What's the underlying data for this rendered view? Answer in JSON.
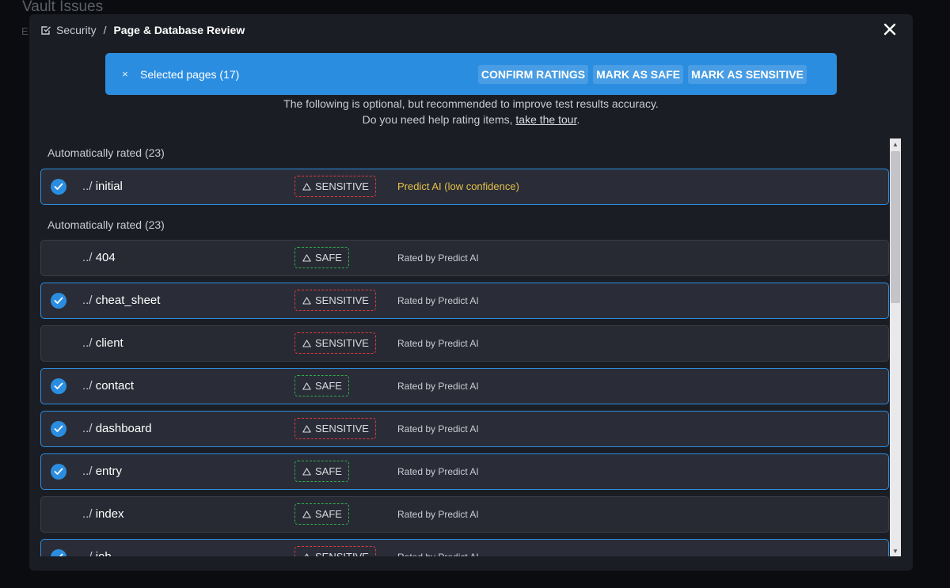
{
  "background": {
    "title": "Vault Issues",
    "letter": "E"
  },
  "breadcrumb": {
    "parent": "Security",
    "separator": "/",
    "current": "Page & Database Review"
  },
  "banner": {
    "close_glyph": "×",
    "selected_label": "Selected pages (17)",
    "actions": {
      "confirm": "CONFIRM RATINGS",
      "safe": "MARK AS SAFE",
      "sensitive": "MARK AS SENSITIVE"
    }
  },
  "hint": {
    "line1": "The following is optional, but recommended to improve test results accuracy.",
    "line2_prefix": "Do you need help rating items, ",
    "line2_link": "take the tour",
    "line2_suffix": "."
  },
  "sections": [
    {
      "label": "Automatically rated (23)"
    },
    {
      "label": "Automatically rated (23)"
    }
  ],
  "rows": [
    {
      "prefix": "../",
      "name": "initial",
      "rating": "SENSITIVE",
      "source": "Predict AI (low confidence)",
      "selected": true
    },
    {
      "prefix": "../",
      "name": "404",
      "rating": "SAFE",
      "source": "Rated by Predict AI",
      "selected": false
    },
    {
      "prefix": "../",
      "name": "cheat_sheet",
      "rating": "SENSITIVE",
      "source": "Rated by Predict AI",
      "selected": true
    },
    {
      "prefix": "../",
      "name": "client",
      "rating": "SENSITIVE",
      "source": "Rated by Predict AI",
      "selected": false
    },
    {
      "prefix": "../",
      "name": "contact",
      "rating": "SAFE",
      "source": "Rated by Predict AI",
      "selected": true
    },
    {
      "prefix": "../",
      "name": "dashboard",
      "rating": "SENSITIVE",
      "source": "Rated by Predict AI",
      "selected": true
    },
    {
      "prefix": "../",
      "name": "entry",
      "rating": "SAFE",
      "source": "Rated by Predict AI",
      "selected": true
    },
    {
      "prefix": "../",
      "name": "index",
      "rating": "SAFE",
      "source": "Rated by Predict AI",
      "selected": false
    },
    {
      "prefix": "../",
      "name": "job",
      "rating": "SENSITIVE",
      "source": "Rated by Predict AI",
      "selected": true
    }
  ],
  "scrollbar": {
    "up_glyph": "▲",
    "down_glyph": "▼"
  },
  "colors": {
    "accent": "#2b8de0",
    "sensitive": "#e0393e",
    "safe": "#2fae4e",
    "ai_low_confidence": "#e4c04a"
  },
  "icons": {
    "breadcrumb": "checkbox-icon",
    "close": "close-icon",
    "selected": "check-circle-icon",
    "rating": "warning-triangle-icon"
  }
}
